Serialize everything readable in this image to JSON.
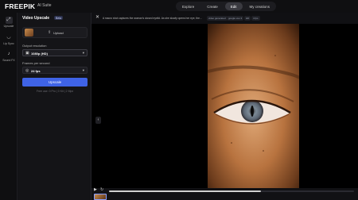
{
  "topbar": {
    "logo": "FREEPIK",
    "suite": "AI Suite",
    "nav": [
      "Explore",
      "Create",
      "Edit",
      "My creations"
    ],
    "active_nav": "Edit"
  },
  "rail": {
    "items": [
      {
        "label": "Upscale",
        "icon": "upscale-icon",
        "active": true
      },
      {
        "label": "Lip Sync",
        "icon": "lip-sync-icon",
        "active": false
      },
      {
        "label": "Sound FX",
        "icon": "sound-fx-icon",
        "active": false
      }
    ]
  },
  "panel": {
    "title": "Video Upscale",
    "badge": "Beta",
    "upload_label": "Upload",
    "resolution_label": "Output resolution",
    "resolution_value": "1080p (HD)",
    "fps_label": "Frames per second",
    "fps_value": "24 fps",
    "button": "Upscale",
    "note": "Free use: 0 Pro | 0 Kit | 2 Mpx"
  },
  "main": {
    "prompt": "A macro shot captures the woman's closed eyelid. As she slowly opens her eye, the...",
    "tags": [
      "video generated",
      "google veo 3",
      "HD",
      "4 fps"
    ],
    "progress": 0.62
  },
  "colors": {
    "accent": "#3f63e6",
    "background": "#0d0d0f"
  }
}
